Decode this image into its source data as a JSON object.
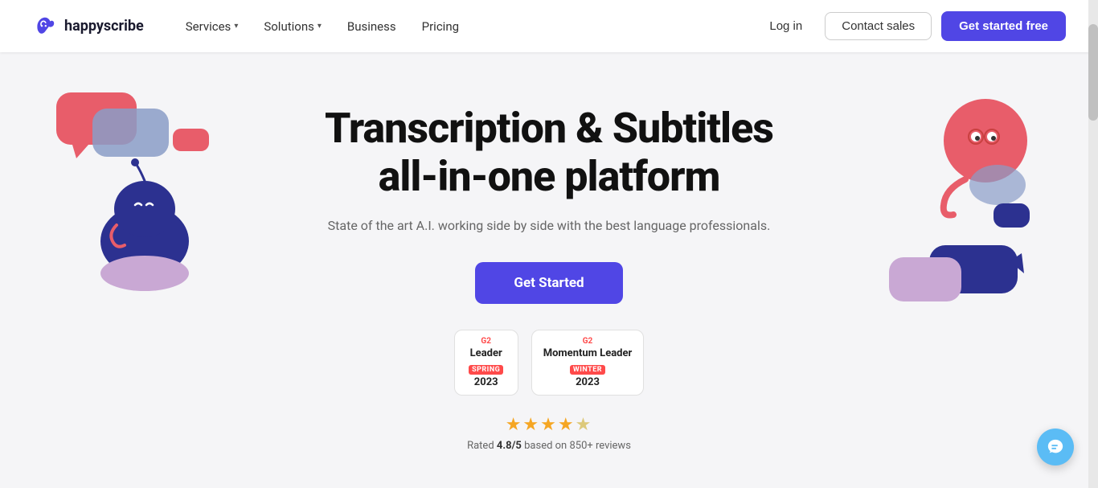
{
  "brand": {
    "name": "happyscribe",
    "logo_alt": "HappyScribe Logo"
  },
  "navbar": {
    "services_label": "Services",
    "solutions_label": "Solutions",
    "business_label": "Business",
    "pricing_label": "Pricing",
    "login_label": "Log in",
    "contact_sales_label": "Contact sales",
    "get_started_label": "Get started free"
  },
  "hero": {
    "title_line1": "Transcription & Subtitles",
    "title_line2": "all-in-one platform",
    "subtitle": "State of the art A.I. working side by side with the best language professionals.",
    "cta_label": "Get Started",
    "badge1": {
      "g2_label": "G2",
      "title": "Leader",
      "season": "SPRING",
      "year": "2023"
    },
    "badge2": {
      "g2_label": "G2",
      "title": "Momentum Leader",
      "season": "WINTER",
      "year": "2023"
    },
    "stars": "★★★★★",
    "rating_value": "4.8/5",
    "rating_text": "Rated",
    "rating_based": "based on 850+ reviews"
  },
  "colors": {
    "brand_purple": "#5046e5",
    "star_gold": "#f5a623",
    "coral": "#e85d6a",
    "blue_dark": "#2c3190",
    "blue_medium": "#8a9cc7",
    "pink_light": "#c9a8d4",
    "bubble_teal": "#5bbcf5"
  }
}
